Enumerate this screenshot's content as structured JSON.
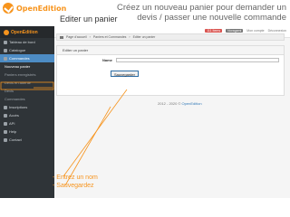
{
  "slide": {
    "brand": "OpenEdition",
    "instruction_line1": "Créez un nouveau panier pour demander un",
    "instruction_line2": "devis / passer une nouvelle commande"
  },
  "app": {
    "logo": "OpenEdition",
    "sidebar": {
      "items": [
        {
          "label": "Tableau de bord",
          "icon": "dashboard-icon"
        },
        {
          "label": "Catalogue",
          "icon": "book-icon"
        },
        {
          "label": "Commandes",
          "icon": "cart-icon"
        }
      ],
      "sub_items": [
        {
          "label": "Nouveau panier"
        },
        {
          "label": "Paniers enregistrés"
        },
        {
          "label": "Devis en attente"
        },
        {
          "label": "Devis"
        },
        {
          "label": "Commandes"
        }
      ],
      "more_items": [
        {
          "label": "Inscriptions",
          "icon": "users-icon"
        },
        {
          "label": "Accès",
          "icon": "key-icon"
        },
        {
          "label": "API",
          "icon": "api-icon"
        },
        {
          "label": "Help",
          "icon": "help-icon"
        },
        {
          "label": "Contact",
          "icon": "mail-icon"
        }
      ]
    },
    "topbar": {
      "badge1": "111 Items",
      "badge2": "Noragami",
      "account": "Mon compte",
      "logout": "Déconnexion"
    },
    "page_title": "Editer un panier",
    "breadcrumb": [
      "Page d'accueil",
      "Paniers et Commandes",
      "Editer un panier"
    ],
    "panel_title": "Editer un panier",
    "form": {
      "name_label": "Name",
      "name_value": "",
      "save_label": "Sauvegarder"
    },
    "footer": {
      "prefix": "2012 - 2020 ©",
      "link": "OpenEdition"
    }
  },
  "notes": {
    "line1": "-  Entrez un nom",
    "line2": "-  Sauvegardez"
  },
  "colors": {
    "accent": "#f7941d",
    "sidebar": "#2f3438",
    "active": "#4d8cc4"
  }
}
